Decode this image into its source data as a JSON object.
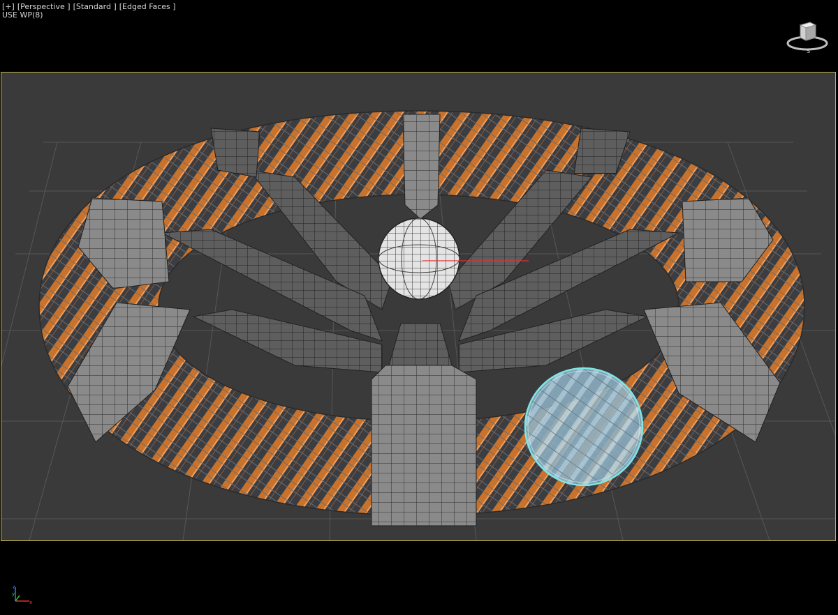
{
  "viewport": {
    "menu_label": "[+]",
    "view_label": "[Perspective ]",
    "shading_label": "[Standard ]",
    "display_label": "[Edged Faces ]",
    "stats": "USE WP(8)"
  },
  "viewcube": {
    "icon": "viewcube-icon",
    "compass_south": "S"
  },
  "axis_tripod": {
    "z_label": "z",
    "y_label": "y",
    "x_label": "x"
  },
  "colors": {
    "background": "#000000",
    "viewport_bg": "#3a3a3a",
    "active_border": "#c6b24a",
    "tube_orange": "#c8722c",
    "mesh_gray": "#8a8a8a",
    "brush_cyan": "#7fe6e6"
  }
}
